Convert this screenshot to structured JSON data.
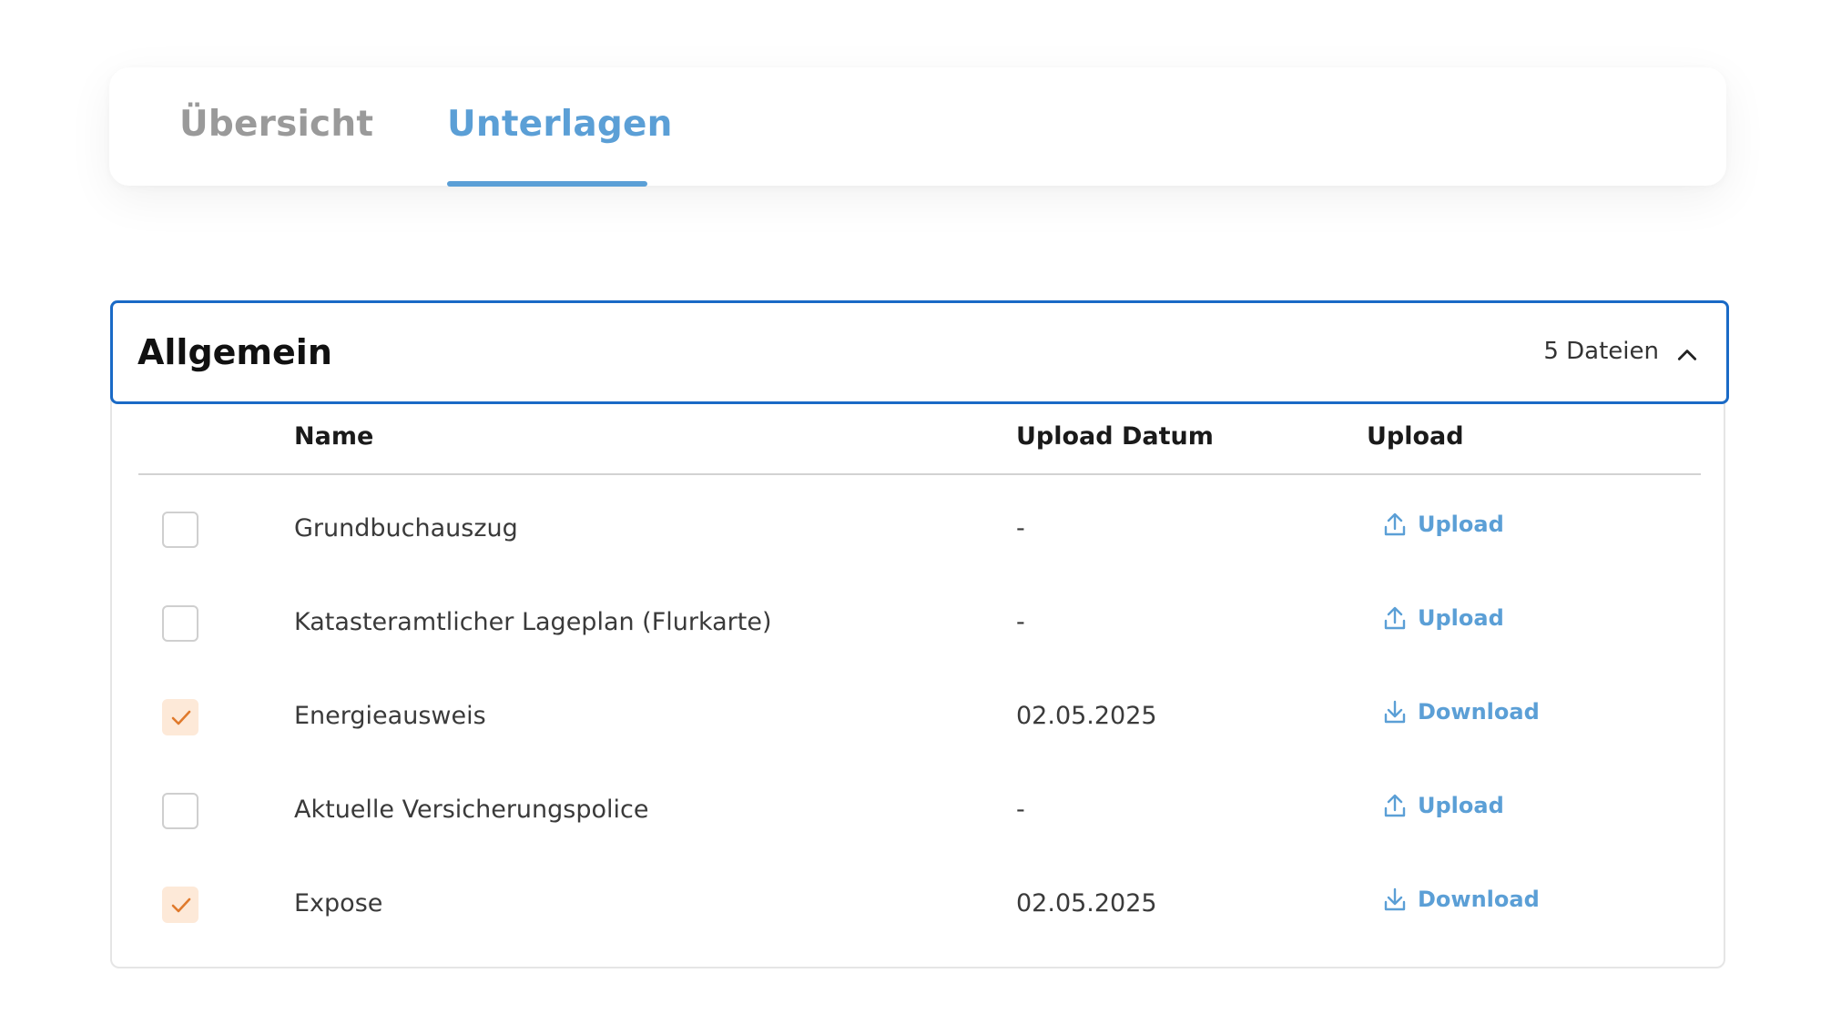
{
  "tabs": {
    "overview_label": "Übersicht",
    "documents_label": "Unterlagen",
    "active": "documents"
  },
  "section": {
    "title": "Allgemein",
    "file_count": "5 Dateien",
    "expanded": true
  },
  "table": {
    "headers": {
      "name": "Name",
      "date": "Upload Datum",
      "action": "Upload"
    },
    "rows": [
      {
        "checked": false,
        "name": "Grundbuchauszug",
        "date": "-",
        "action_label": "Upload",
        "action_icon": "upload-icon"
      },
      {
        "checked": false,
        "name": "Katasteramtlicher Lageplan (Flurkarte)",
        "date": "-",
        "action_label": "Upload",
        "action_icon": "upload-icon"
      },
      {
        "checked": true,
        "name": "Energieausweis",
        "date": "02.05.2025",
        "action_label": "Download",
        "action_icon": "download-icon"
      },
      {
        "checked": false,
        "name": "Aktuelle Versicherungspolice",
        "date": "-",
        "action_label": "Upload",
        "action_icon": "upload-icon"
      },
      {
        "checked": true,
        "name": "Expose",
        "date": "02.05.2025",
        "action_label": "Download",
        "action_icon": "download-icon"
      }
    ]
  },
  "colors": {
    "accent": "#5b9fd6",
    "header_border": "#1a6ac6",
    "checked_bg": "#fde9d8",
    "check_mark": "#e07a2c"
  }
}
